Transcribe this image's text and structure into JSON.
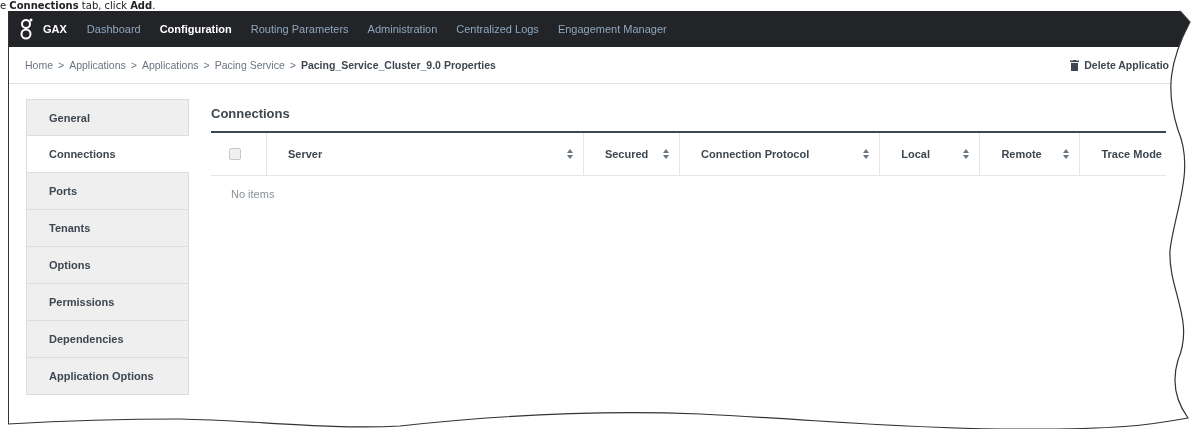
{
  "caption": "e **Connections** tab, click **Add**.",
  "navbar": {
    "logo_text": "GAX",
    "items": [
      {
        "label": "Dashboard",
        "selected": false
      },
      {
        "label": "Configuration",
        "selected": true
      },
      {
        "label": "Routing Parameters",
        "selected": false
      },
      {
        "label": "Administration",
        "selected": false
      },
      {
        "label": "Centralized Logs",
        "selected": false
      },
      {
        "label": "Engagement Manager",
        "selected": false
      }
    ]
  },
  "breadcrumb": {
    "items": [
      "Home",
      "Applications",
      "Applications",
      "Pacing Service"
    ],
    "separator": ">",
    "current": "Pacing_Service_Cluster_9.0 Properties"
  },
  "delete_button": "Delete Applicatio",
  "sidebar": {
    "items": [
      {
        "label": "General",
        "selected": false
      },
      {
        "label": "Connections",
        "selected": true
      },
      {
        "label": "Ports",
        "selected": false
      },
      {
        "label": "Tenants",
        "selected": false
      },
      {
        "label": "Options",
        "selected": false
      },
      {
        "label": "Permissions",
        "selected": false
      },
      {
        "label": "Dependencies",
        "selected": false
      },
      {
        "label": "Application Options",
        "selected": false
      }
    ]
  },
  "section_title": "Connections",
  "table": {
    "select_all_checked": false,
    "columns": [
      {
        "label": "Server",
        "sortable": true
      },
      {
        "label": "Secured",
        "sortable": true
      },
      {
        "label": "Connection Protocol",
        "sortable": true
      },
      {
        "label": "Local",
        "sortable": true
      },
      {
        "label": "Remote",
        "sortable": true
      },
      {
        "label": "Trace Mode"
      }
    ],
    "empty_text": "No items"
  }
}
